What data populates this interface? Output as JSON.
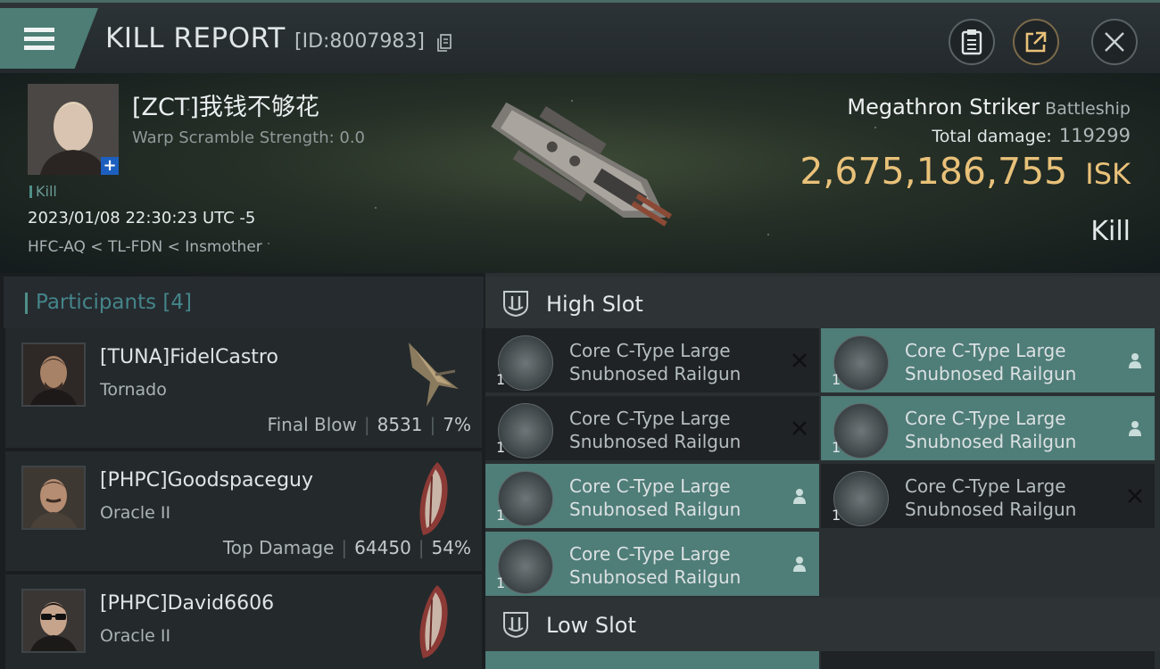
{
  "header": {
    "title": "KILL REPORT",
    "report_id": "[ID:8007983]",
    "icons": [
      "menu-icon",
      "copy-icon",
      "clipboard-icon",
      "share-icon",
      "close-icon"
    ]
  },
  "victim": {
    "name": "[ZCT]我钱不够花",
    "scramble": "Warp Scramble Strength: 0.0",
    "kill_tag": "Kill",
    "time": "2023/01/08 22:30:23 UTC -5",
    "location": "HFC-AQ < TL-FDN < Insmother",
    "ship_name": "Megathron Striker",
    "ship_class": "Battleship",
    "total_damage_label": "Total damage:",
    "total_damage": "119299",
    "isk_value": "2,675,186,755",
    "isk_unit": "ISK",
    "kill_type": "Kill"
  },
  "participants": {
    "title": "Participants",
    "count": "[4]",
    "items": [
      {
        "name": "[TUNA]FidelCastro",
        "ship": "Tornado",
        "stat_label": "Final Blow",
        "damage": "8531",
        "percent": "7%"
      },
      {
        "name": "[PHPC]Goodspaceguy",
        "ship": "Oracle II",
        "stat_label": "Top Damage",
        "damage": "64450",
        "percent": "54%"
      },
      {
        "name": "[PHPC]David6606",
        "ship": "Oracle II",
        "stat_label": "",
        "damage": "",
        "percent": ""
      }
    ]
  },
  "fittings": {
    "high_slot_title": "High Slot",
    "low_slot_title": "Low Slot",
    "high_modules": [
      {
        "line1": "Core C-Type Large",
        "line2": "Snubnosed Railgun",
        "qty": "1",
        "status": "destroyed"
      },
      {
        "line1": "Core C-Type Large",
        "line2": "Snubnosed Railgun",
        "qty": "1",
        "status": "dropped"
      },
      {
        "line1": "Core C-Type Large",
        "line2": "Snubnosed Railgun",
        "qty": "1",
        "status": "destroyed"
      },
      {
        "line1": "Core C-Type Large",
        "line2": "Snubnosed Railgun",
        "qty": "1",
        "status": "dropped"
      },
      {
        "line1": "Core C-Type Large",
        "line2": "Snubnosed Railgun",
        "qty": "1",
        "status": "dropped"
      },
      {
        "line1": "Core C-Type Large",
        "line2": "Snubnosed Railgun",
        "qty": "1",
        "status": "destroyed"
      },
      {
        "line1": "Core C-Type Large",
        "line2": "Snubnosed Railgun",
        "qty": "1",
        "status": "dropped"
      }
    ]
  },
  "colors": {
    "accent_teal": "#4d7d75",
    "isk_gold": "#e9c179",
    "dropped_cell": "#4f7d78",
    "destroyed_cell": "#1f2326"
  }
}
